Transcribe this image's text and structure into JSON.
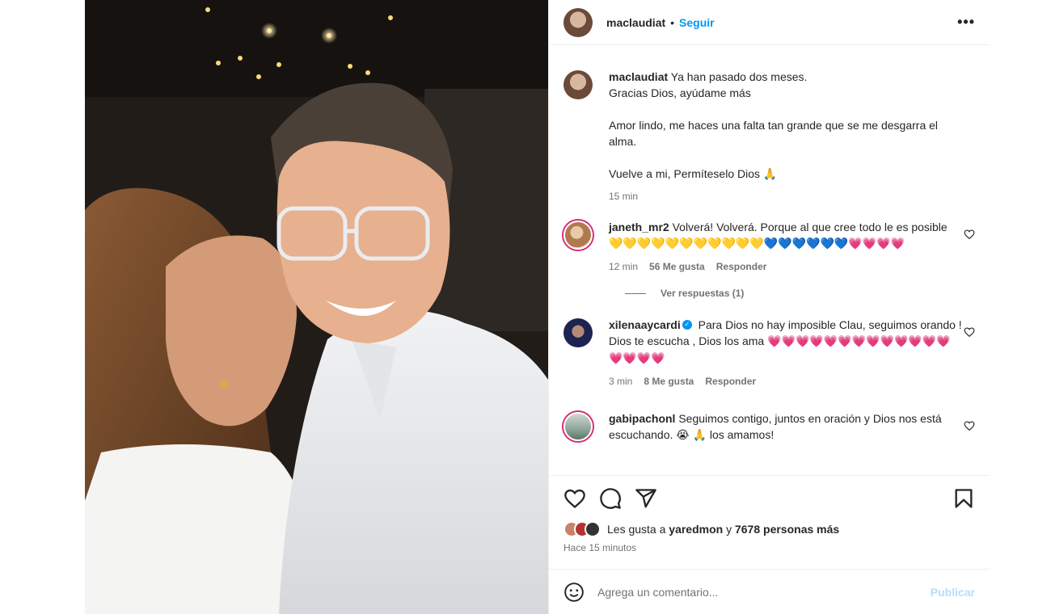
{
  "post": {
    "author": "maclaudiat",
    "follow_label": "Seguir",
    "separator": "•",
    "more_label": "•••"
  },
  "caption": {
    "username": "maclaudiat",
    "text": "Ya han pasado dos meses.\nGracias Dios, ayúdame más\n\nAmor lindo, me haces una falta tan grande que se me desgarra el alma.\n\nVuelve a mi, Permíteselo Dios 🙏",
    "time": "15 min"
  },
  "comments": [
    {
      "username": "janeth_mr2",
      "verified": false,
      "text": "Volverá! Volverá. Porque al que cree todo le es posible",
      "emojis": "💛💛💛💛💛💛💛💛💛💛💛💙💙💙💙💙💙💗💗💗💗",
      "time": "12 min",
      "likes": "56 Me gusta",
      "reply_label": "Responder",
      "view_replies": "Ver respuestas (1)"
    },
    {
      "username": "xilenaaycardi",
      "verified": true,
      "text": "Para Dios no hay imposible Clau, seguimos orando ! Dios te escucha , Dios los ama",
      "emojis": "💗💗💗💗💗💗💗💗💗💗💗💗💗💗💗💗💗",
      "time": "3 min",
      "likes": "8 Me gusta",
      "reply_label": "Responder"
    },
    {
      "username": "gabipachonl",
      "verified": false,
      "text": "Seguimos contigo, juntos en oración y Dios nos está escuchando. 😭 🙏 los amamos!"
    }
  ],
  "likes": {
    "prefix": "Les gusta a",
    "user": "yaredmon",
    "middle": "y",
    "count": "7678 personas más",
    "time_ago": "Hace 15 minutos"
  },
  "composer": {
    "placeholder": "Agrega un comentario...",
    "publish_label": "Publicar"
  },
  "colors": {
    "accent": "#0095f6",
    "publish_disabled": "#b2dffc"
  }
}
